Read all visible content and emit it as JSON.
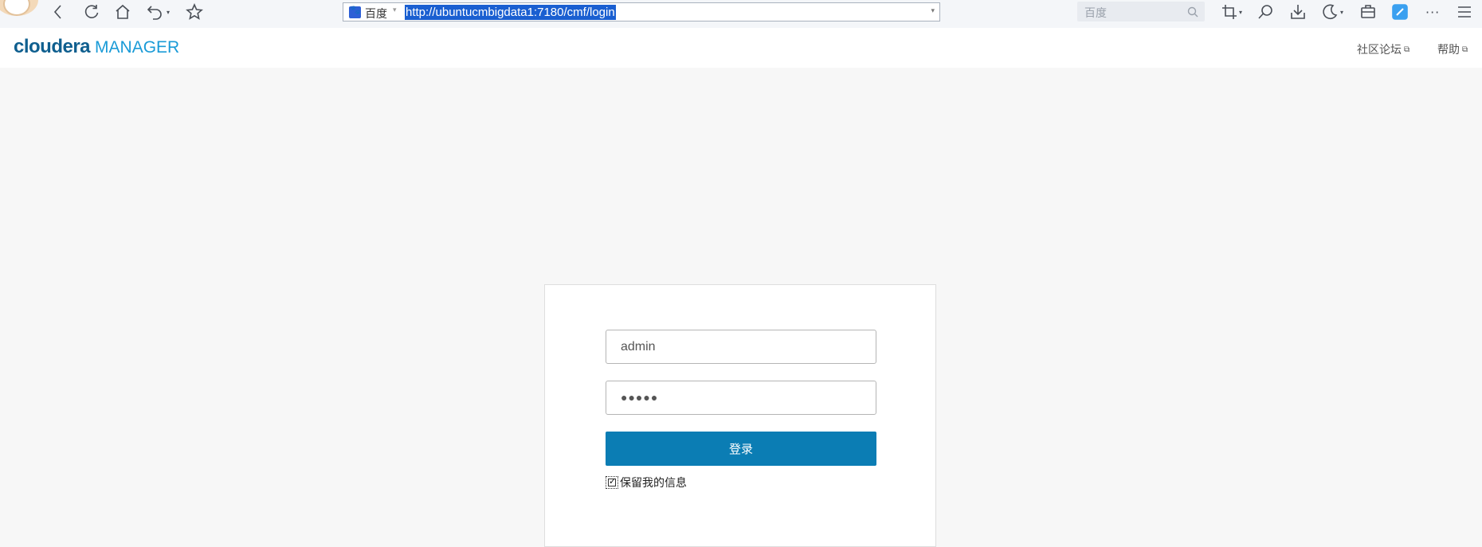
{
  "browser": {
    "search_engine": "百度",
    "url": "http://ubuntucmbigdata1:7180/cmf/login",
    "search_placeholder": "百度"
  },
  "header": {
    "brand_primary": "cloudera",
    "brand_secondary": "MANAGER",
    "links": [
      {
        "label": "社区论坛",
        "icon": "external-link-icon"
      },
      {
        "label": "帮助",
        "icon": "external-link-icon"
      }
    ]
  },
  "login": {
    "username": "admin",
    "password_mask": "●●●●●",
    "submit_label": "登录",
    "remember_label": "保留我的信息",
    "remember_checked": true
  },
  "colors": {
    "brand_dark": "#0f5f8f",
    "brand_light": "#1a9bd7",
    "button": "#0b7db4",
    "page_bg": "#f7f7f7"
  }
}
